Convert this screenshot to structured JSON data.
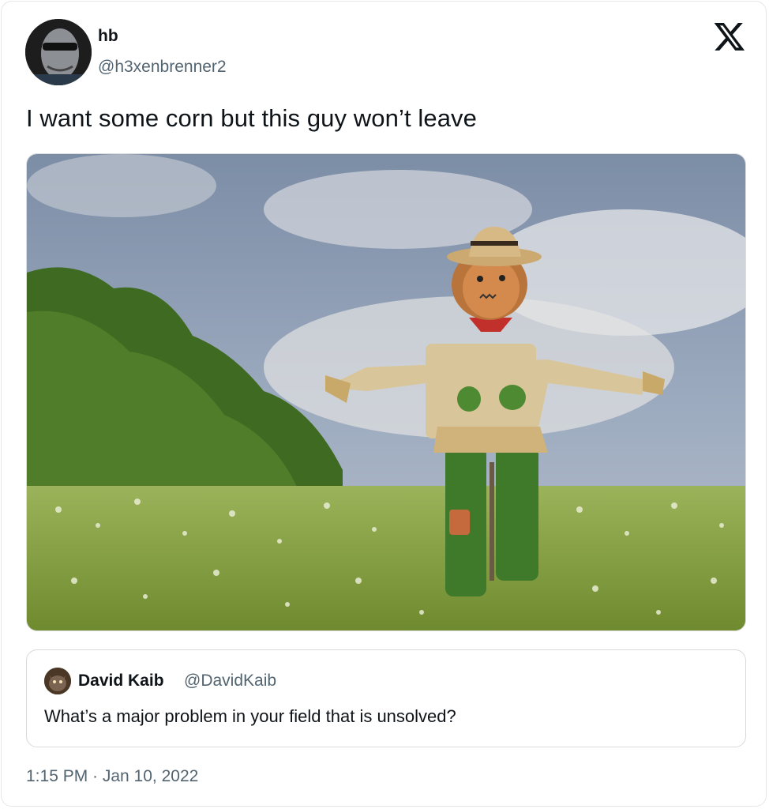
{
  "tweet": {
    "author_name": "hb",
    "author_handle": "@h3xenbrenner2",
    "text": "I want some corn but this guy won’t leave",
    "timestamp": "1:15 PM · Jan 10, 2022",
    "brand_icon": "x-logo-icon",
    "photo_subject": "scarecrow-in-field"
  },
  "quoted_tweet": {
    "author_name": "David Kaib",
    "author_handle": "@DavidKaib",
    "text": "What’s a major problem in your field that is unsolved?"
  },
  "colors": {
    "text_primary": "#0f1419",
    "text_secondary": "#536471",
    "border": "#e6e6e6"
  }
}
